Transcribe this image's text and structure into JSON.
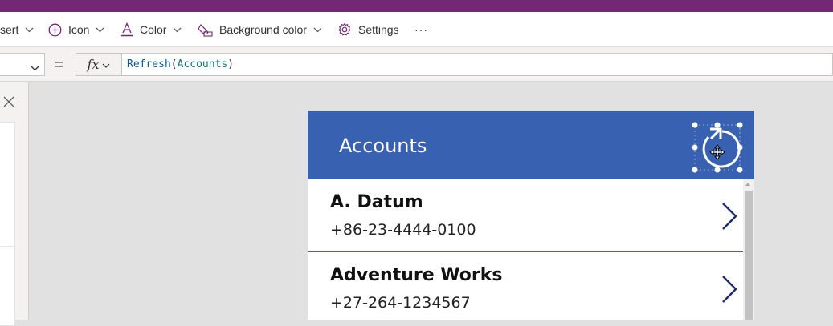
{
  "ribbon": {
    "insert_label": "sert",
    "icon_label": "Icon",
    "color_label": "Color",
    "bgcolor_label": "Background color",
    "settings_label": "Settings",
    "more_label": "···"
  },
  "formula_bar": {
    "equals": "=",
    "fx": "fx",
    "function": "Refresh",
    "open_paren": "(",
    "argument": "Accounts",
    "close_paren": ")"
  },
  "app": {
    "title": "Accounts",
    "header_color": "#3861b1",
    "items": [
      {
        "name": "A. Datum",
        "phone": "+86-23-4444-0100"
      },
      {
        "name": "Adventure Works",
        "phone": "+27-264-1234567"
      }
    ]
  },
  "colors": {
    "titlebar": "#742774",
    "accent_purple": "#742774",
    "canvas": "#e1e1e1"
  },
  "icons": {
    "insert": "chevron-down-icon",
    "icon_menu": "add-circle-icon",
    "color_menu": "font-color-icon",
    "bg_menu": "paint-bucket-icon",
    "settings": "gear-icon",
    "selected_control": "refresh-icon",
    "gallery_next": "chevron-right-icon"
  }
}
